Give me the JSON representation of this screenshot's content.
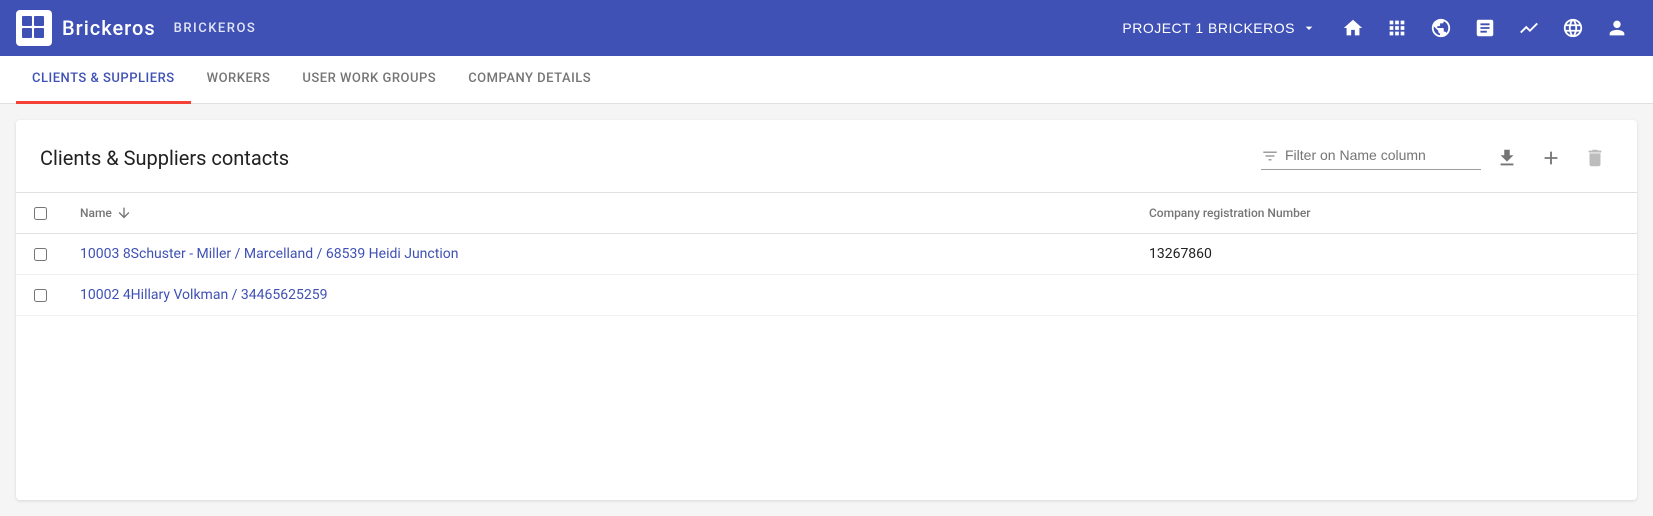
{
  "app": {
    "logo_text": "Brickeros",
    "app_name": "BRICKEROS"
  },
  "top_nav": {
    "project_label": "PROJECT 1 BRICKEROS",
    "icons": [
      "home",
      "apps",
      "globe",
      "list",
      "chart",
      "language",
      "account"
    ]
  },
  "secondary_nav": {
    "tabs": [
      {
        "label": "CLIENTS & SUPPLIERS",
        "active": true
      },
      {
        "label": "WORKERS",
        "active": false
      },
      {
        "label": "USER WORK GROUPS",
        "active": false
      },
      {
        "label": "COMPANY DETAILS",
        "active": false
      }
    ]
  },
  "main": {
    "page_title": "Clients & Suppliers contacts",
    "filter_placeholder": "Filter on Name column",
    "table": {
      "columns": [
        {
          "key": "name",
          "label": "Name",
          "sortable": true
        },
        {
          "key": "crn",
          "label": "Company registration Number",
          "sortable": false
        }
      ],
      "rows": [
        {
          "name": "10003 8Schuster - Miller / Marcelland / 68539 Heidi Junction",
          "crn": "13267860"
        },
        {
          "name": "10002 4Hillary Volkman / 34465625259",
          "crn": ""
        }
      ]
    },
    "toolbar": {
      "download_label": "download",
      "add_label": "add",
      "delete_label": "delete"
    }
  }
}
